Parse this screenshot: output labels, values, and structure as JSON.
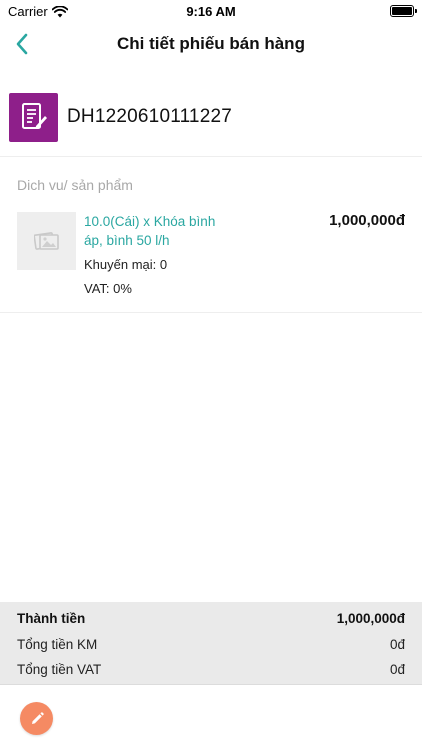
{
  "status_bar": {
    "carrier": "Carrier",
    "time": "9:16 AM"
  },
  "nav": {
    "title": "Chi tiết phiếu bán hàng",
    "back_icon": "chevron-left-icon"
  },
  "order": {
    "code": "DH1220610111227",
    "icon": "invoice-icon",
    "icon_color": "#8e1f8a"
  },
  "section": {
    "label": "Dich vu/ sản phẩm"
  },
  "items": [
    {
      "name": "10.0(Cái) x Khóa bình áp, bình 50 l/h",
      "price": "1,000,000đ",
      "promo": "Khuyến mại: 0",
      "vat": "VAT: 0%",
      "name_color": "#2aa7a1"
    }
  ],
  "summary": {
    "total_label": "Thành tiền",
    "total_value": "1,000,000đ",
    "promo_label": "Tổng tiền KM",
    "promo_value": "0đ",
    "vat_label": "Tổng tiền VAT",
    "vat_value": "0đ"
  },
  "footer": {
    "edit_icon": "pencil-icon",
    "edit_color": "#f58a63"
  }
}
